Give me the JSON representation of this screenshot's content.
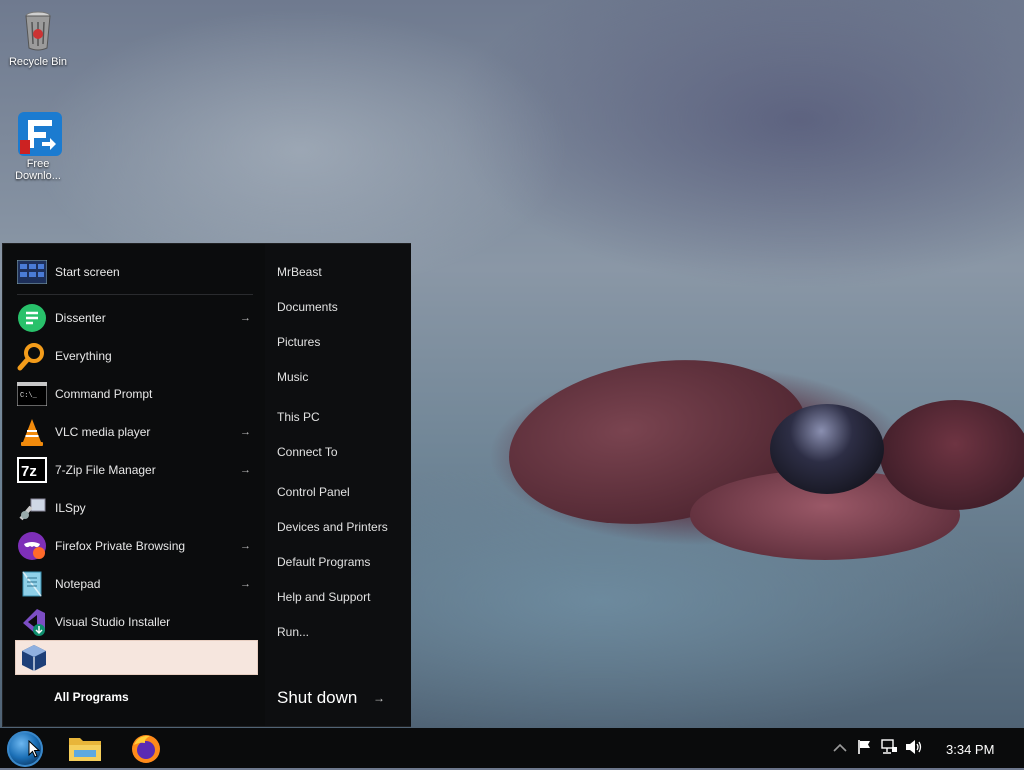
{
  "desktop": {
    "icons": [
      {
        "label": "Recycle Bin"
      },
      {
        "label": "Free Downlo..."
      }
    ]
  },
  "start_menu": {
    "pinned": {
      "label": "Start screen"
    },
    "programs": [
      {
        "label": "Dissenter",
        "has_submenu": true,
        "icon": "dissenter-icon"
      },
      {
        "label": "Everything",
        "has_submenu": false,
        "icon": "everything-search-icon"
      },
      {
        "label": "Command Prompt",
        "has_submenu": false,
        "icon": "command-prompt-icon"
      },
      {
        "label": "VLC media player",
        "has_submenu": true,
        "icon": "vlc-icon"
      },
      {
        "label": "7-Zip File Manager",
        "has_submenu": true,
        "icon": "7zip-icon"
      },
      {
        "label": "ILSpy",
        "has_submenu": false,
        "icon": "ilspy-icon"
      },
      {
        "label": "Firefox Private Browsing",
        "has_submenu": true,
        "icon": "firefox-private-icon"
      },
      {
        "label": "Notepad",
        "has_submenu": true,
        "icon": "notepad-icon"
      },
      {
        "label": "Visual Studio Installer",
        "has_submenu": false,
        "icon": "visual-studio-installer-icon"
      }
    ],
    "highlighted_item": {
      "label": "",
      "icon": "virtualbox-icon"
    },
    "all_programs_label": "All Programs",
    "right_links": [
      {
        "label": "MrBeast"
      },
      {
        "label": "Documents"
      },
      {
        "label": "Pictures"
      },
      {
        "label": "Music"
      },
      {
        "label": "This PC"
      },
      {
        "label": "Connect To"
      },
      {
        "label": "Control Panel"
      },
      {
        "label": "Devices and Printers"
      },
      {
        "label": "Default Programs"
      },
      {
        "label": "Help and Support"
      },
      {
        "label": "Run..."
      }
    ],
    "shutdown_label": "Shut down",
    "arrow_glyph": "→"
  },
  "taskbar": {
    "pinned": [
      {
        "name": "file-explorer-icon"
      },
      {
        "name": "firefox-icon"
      }
    ],
    "tray_icons": [
      "chevron-up-icon",
      "flag-icon",
      "network-icon",
      "volume-icon"
    ],
    "clock": "3:34 PM"
  },
  "colors": {
    "menu_bg": "#0b0c0d",
    "highlight": "#f6e6de",
    "taskbar": "#0a0b0c"
  }
}
